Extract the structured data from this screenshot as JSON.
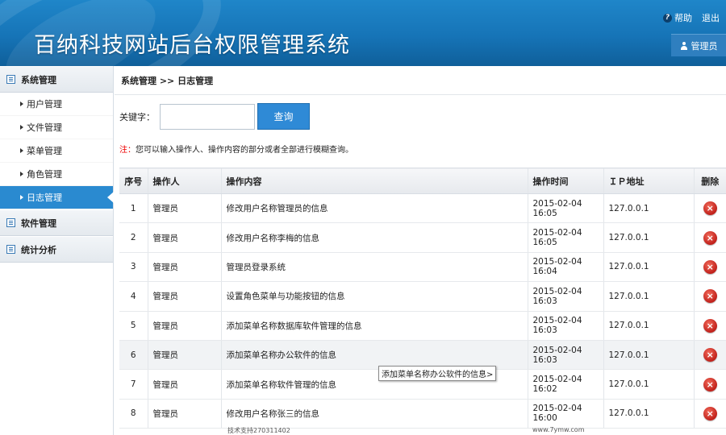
{
  "header": {
    "title": "百纳科技网站后台权限管理系统",
    "help": "帮助",
    "logout": "退出",
    "user": "管理员"
  },
  "sidebar": {
    "groups": [
      {
        "label": "系统管理",
        "items": [
          "用户管理",
          "文件管理",
          "菜单管理",
          "角色管理",
          "日志管理"
        ]
      },
      {
        "label": "软件管理"
      },
      {
        "label": "统计分析"
      }
    ]
  },
  "main": {
    "breadcrumb": "系统管理 >> 日志管理",
    "search": {
      "label": "关键字：",
      "value": "",
      "button": "查询"
    },
    "note_prefix": "注：",
    "note": "您可以输入操作人、操作内容的部分或者全部进行模糊查询。",
    "columns": [
      "序号",
      "操作人",
      "操作内容",
      "操作时间",
      "ＩＰ地址",
      "删除"
    ],
    "rows": [
      [
        "1",
        "管理员",
        "修改用户名称管理员的信息",
        "2015-02-04 16:05",
        "127.0.0.1"
      ],
      [
        "2",
        "管理员",
        "修改用户名称李梅的信息",
        "2015-02-04 16:05",
        "127.0.0.1"
      ],
      [
        "3",
        "管理员",
        "管理员登录系统",
        "2015-02-04 16:04",
        "127.0.0.1"
      ],
      [
        "4",
        "管理员",
        "设置角色菜单与功能按钮的信息",
        "2015-02-04 16:03",
        "127.0.0.1"
      ],
      [
        "5",
        "管理员",
        "添加菜单名称数据库软件管理的信息",
        "2015-02-04 16:03",
        "127.0.0.1"
      ],
      [
        "6",
        "管理员",
        "添加菜单名称办公软件的信息",
        "2015-02-04 16:03",
        "127.0.0.1"
      ],
      [
        "7",
        "管理员",
        "添加菜单名称软件管理的信息",
        "2015-02-04 16:02",
        "127.0.0.1"
      ],
      [
        "8",
        "管理员",
        "修改用户名称张三的信息",
        "2015-02-04 16:00",
        "127.0.0.1"
      ]
    ],
    "tooltip": "添加菜单名称办公软件的信息>"
  },
  "footer": {
    "left": "技术支持2703114​02",
    "right": "www.7ymw.com"
  },
  "colors": {
    "header": "#1674b7",
    "active": "#2a8ad0",
    "delete": "#c0201a"
  }
}
